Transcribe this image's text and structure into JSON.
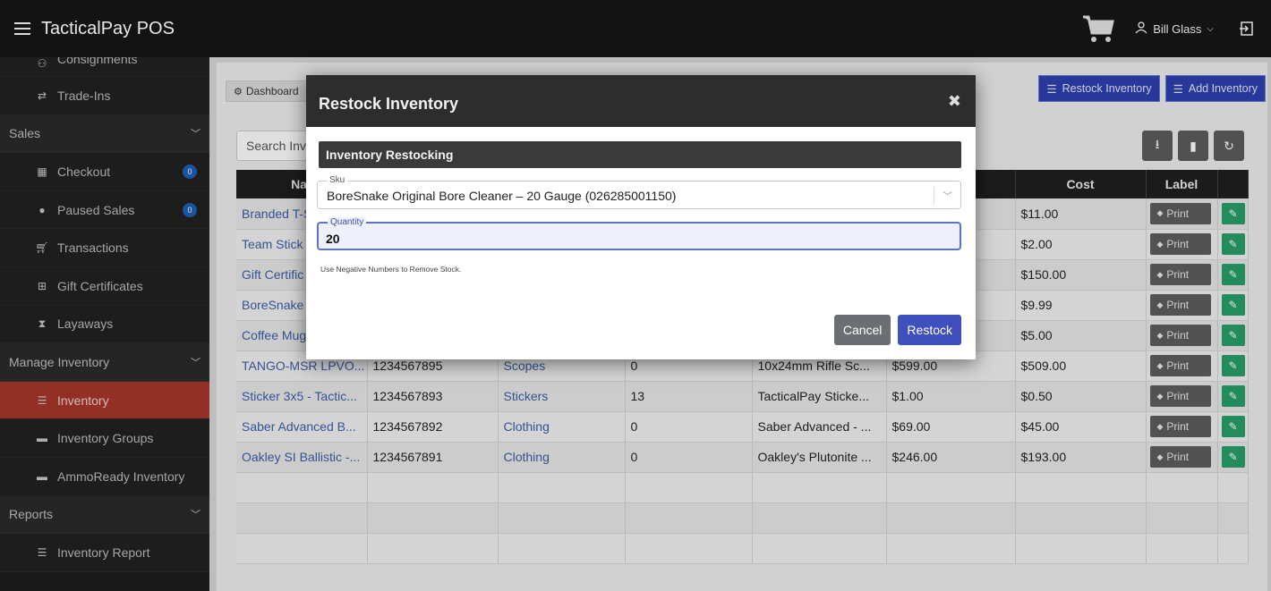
{
  "app": {
    "title": "TacticalPay POS"
  },
  "user": {
    "name": "Bill Glass"
  },
  "sidebar": {
    "top_items": [
      {
        "label": "Consignments",
        "icon": "handshake-icon"
      },
      {
        "label": "Trade-Ins",
        "icon": "swap-icon"
      }
    ],
    "sections": [
      {
        "label": "Sales",
        "items": [
          {
            "label": "Checkout",
            "badge": "0"
          },
          {
            "label": "Paused Sales",
            "badge": "0"
          },
          {
            "label": "Transactions"
          },
          {
            "label": "Gift Certificates"
          },
          {
            "label": "Layaways"
          }
        ]
      },
      {
        "label": "Manage Inventory",
        "items": [
          {
            "label": "Inventory"
          },
          {
            "label": "Inventory Groups"
          },
          {
            "label": "AmmoReady Inventory"
          }
        ]
      },
      {
        "label": "Reports",
        "items": [
          {
            "label": "Inventory Report"
          }
        ]
      }
    ]
  },
  "main": {
    "breadcrumb": "Dashboard",
    "restock_button": "Restock Inventory",
    "add_button": "Add Inventory",
    "search_placeholder": "Search Inv",
    "table": {
      "headers": {
        "name": "Nar",
        "cost": "Cost",
        "label": "Label"
      },
      "print_label": "Print",
      "rows": [
        {
          "name": "Branded T-S",
          "cost": "$11.00"
        },
        {
          "name": "Team Stick",
          "cost": "$2.00"
        },
        {
          "name": "Gift Certific",
          "cost": "$150.00"
        },
        {
          "name": "BoreSnake",
          "cost": "$9.99"
        },
        {
          "name": "Coffee Mug",
          "cost": "$5.00"
        },
        {
          "name": "TANGO-MSR LPVO...",
          "sku": "1234567895",
          "group": "Scopes",
          "qty": "0",
          "desc": "10x24mm Rifle Sc...",
          "price": "$599.00",
          "cost": "$509.00"
        },
        {
          "name": "Sticker 3x5 - Tactic...",
          "sku": "1234567893",
          "group": "Stickers",
          "qty": "13",
          "desc": "TacticalPay Sticke...",
          "price": "$1.00",
          "cost": "$0.50"
        },
        {
          "name": "Saber Advanced B...",
          "sku": "1234567892",
          "group": "Clothing",
          "qty": "0",
          "desc": "Saber Advanced - ...",
          "price": "$69.00",
          "cost": "$45.00"
        },
        {
          "name": "Oakley SI Ballistic -...",
          "sku": "1234567891",
          "group": "Clothing",
          "qty": "0",
          "desc": "Oakley's Plutonite ...",
          "price": "$246.00",
          "cost": "$193.00"
        }
      ]
    }
  },
  "modal": {
    "title": "Restock Inventory",
    "section": "Inventory Restocking",
    "sku_label": "Sku",
    "sku_value": "BoreSnake Original Bore Cleaner – 20 Gauge (026285001150)",
    "qty_label": "Quantity",
    "qty_value": "20",
    "hint": "Use Negative Numbers to Remove Stock.",
    "cancel": "Cancel",
    "restock": "Restock"
  },
  "colors": {
    "active": "#a8372c",
    "primary": "#3f4fbb",
    "success": "#27a06a",
    "topbar": "#131313"
  }
}
